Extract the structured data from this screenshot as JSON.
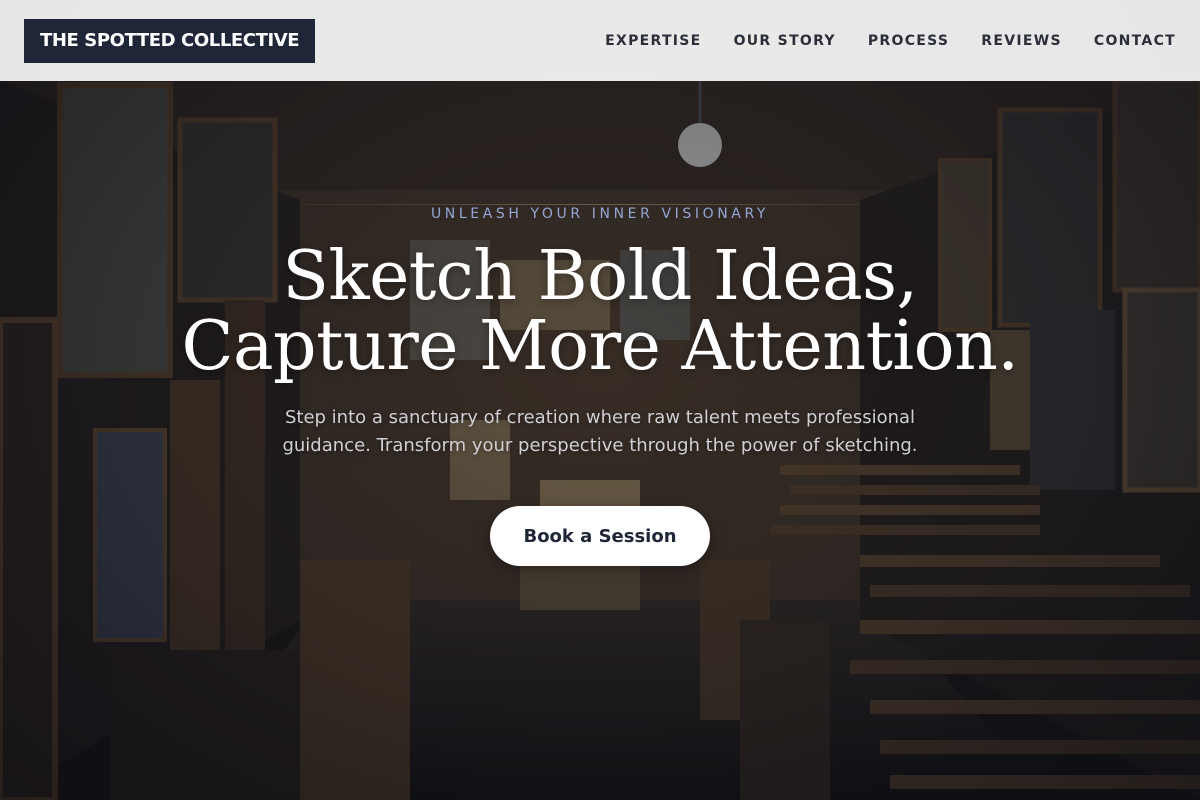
{
  "brand": {
    "name": "THE SPOTTED COLLECTIVE",
    "bg_color": "#1e2638"
  },
  "nav": {
    "items": [
      {
        "label": "EXPERTISE"
      },
      {
        "label": "OUR STORY"
      },
      {
        "label": "PROCESS"
      },
      {
        "label": "REVIEWS"
      },
      {
        "label": "CONTACT"
      }
    ]
  },
  "hero": {
    "eyebrow": "UNLEASH YOUR INNER VISIONARY",
    "headline_line1": "Sketch Bold Ideas,",
    "headline_line2": "Capture More Attention.",
    "subtext": "Step into a sanctuary of creation where raw talent meets professional guidance. Transform your perspective through the power of sketching.",
    "cta_label": "Book a Session",
    "background_image": "art-studio-gallery-photo",
    "accent_color": "#93a6d4"
  }
}
